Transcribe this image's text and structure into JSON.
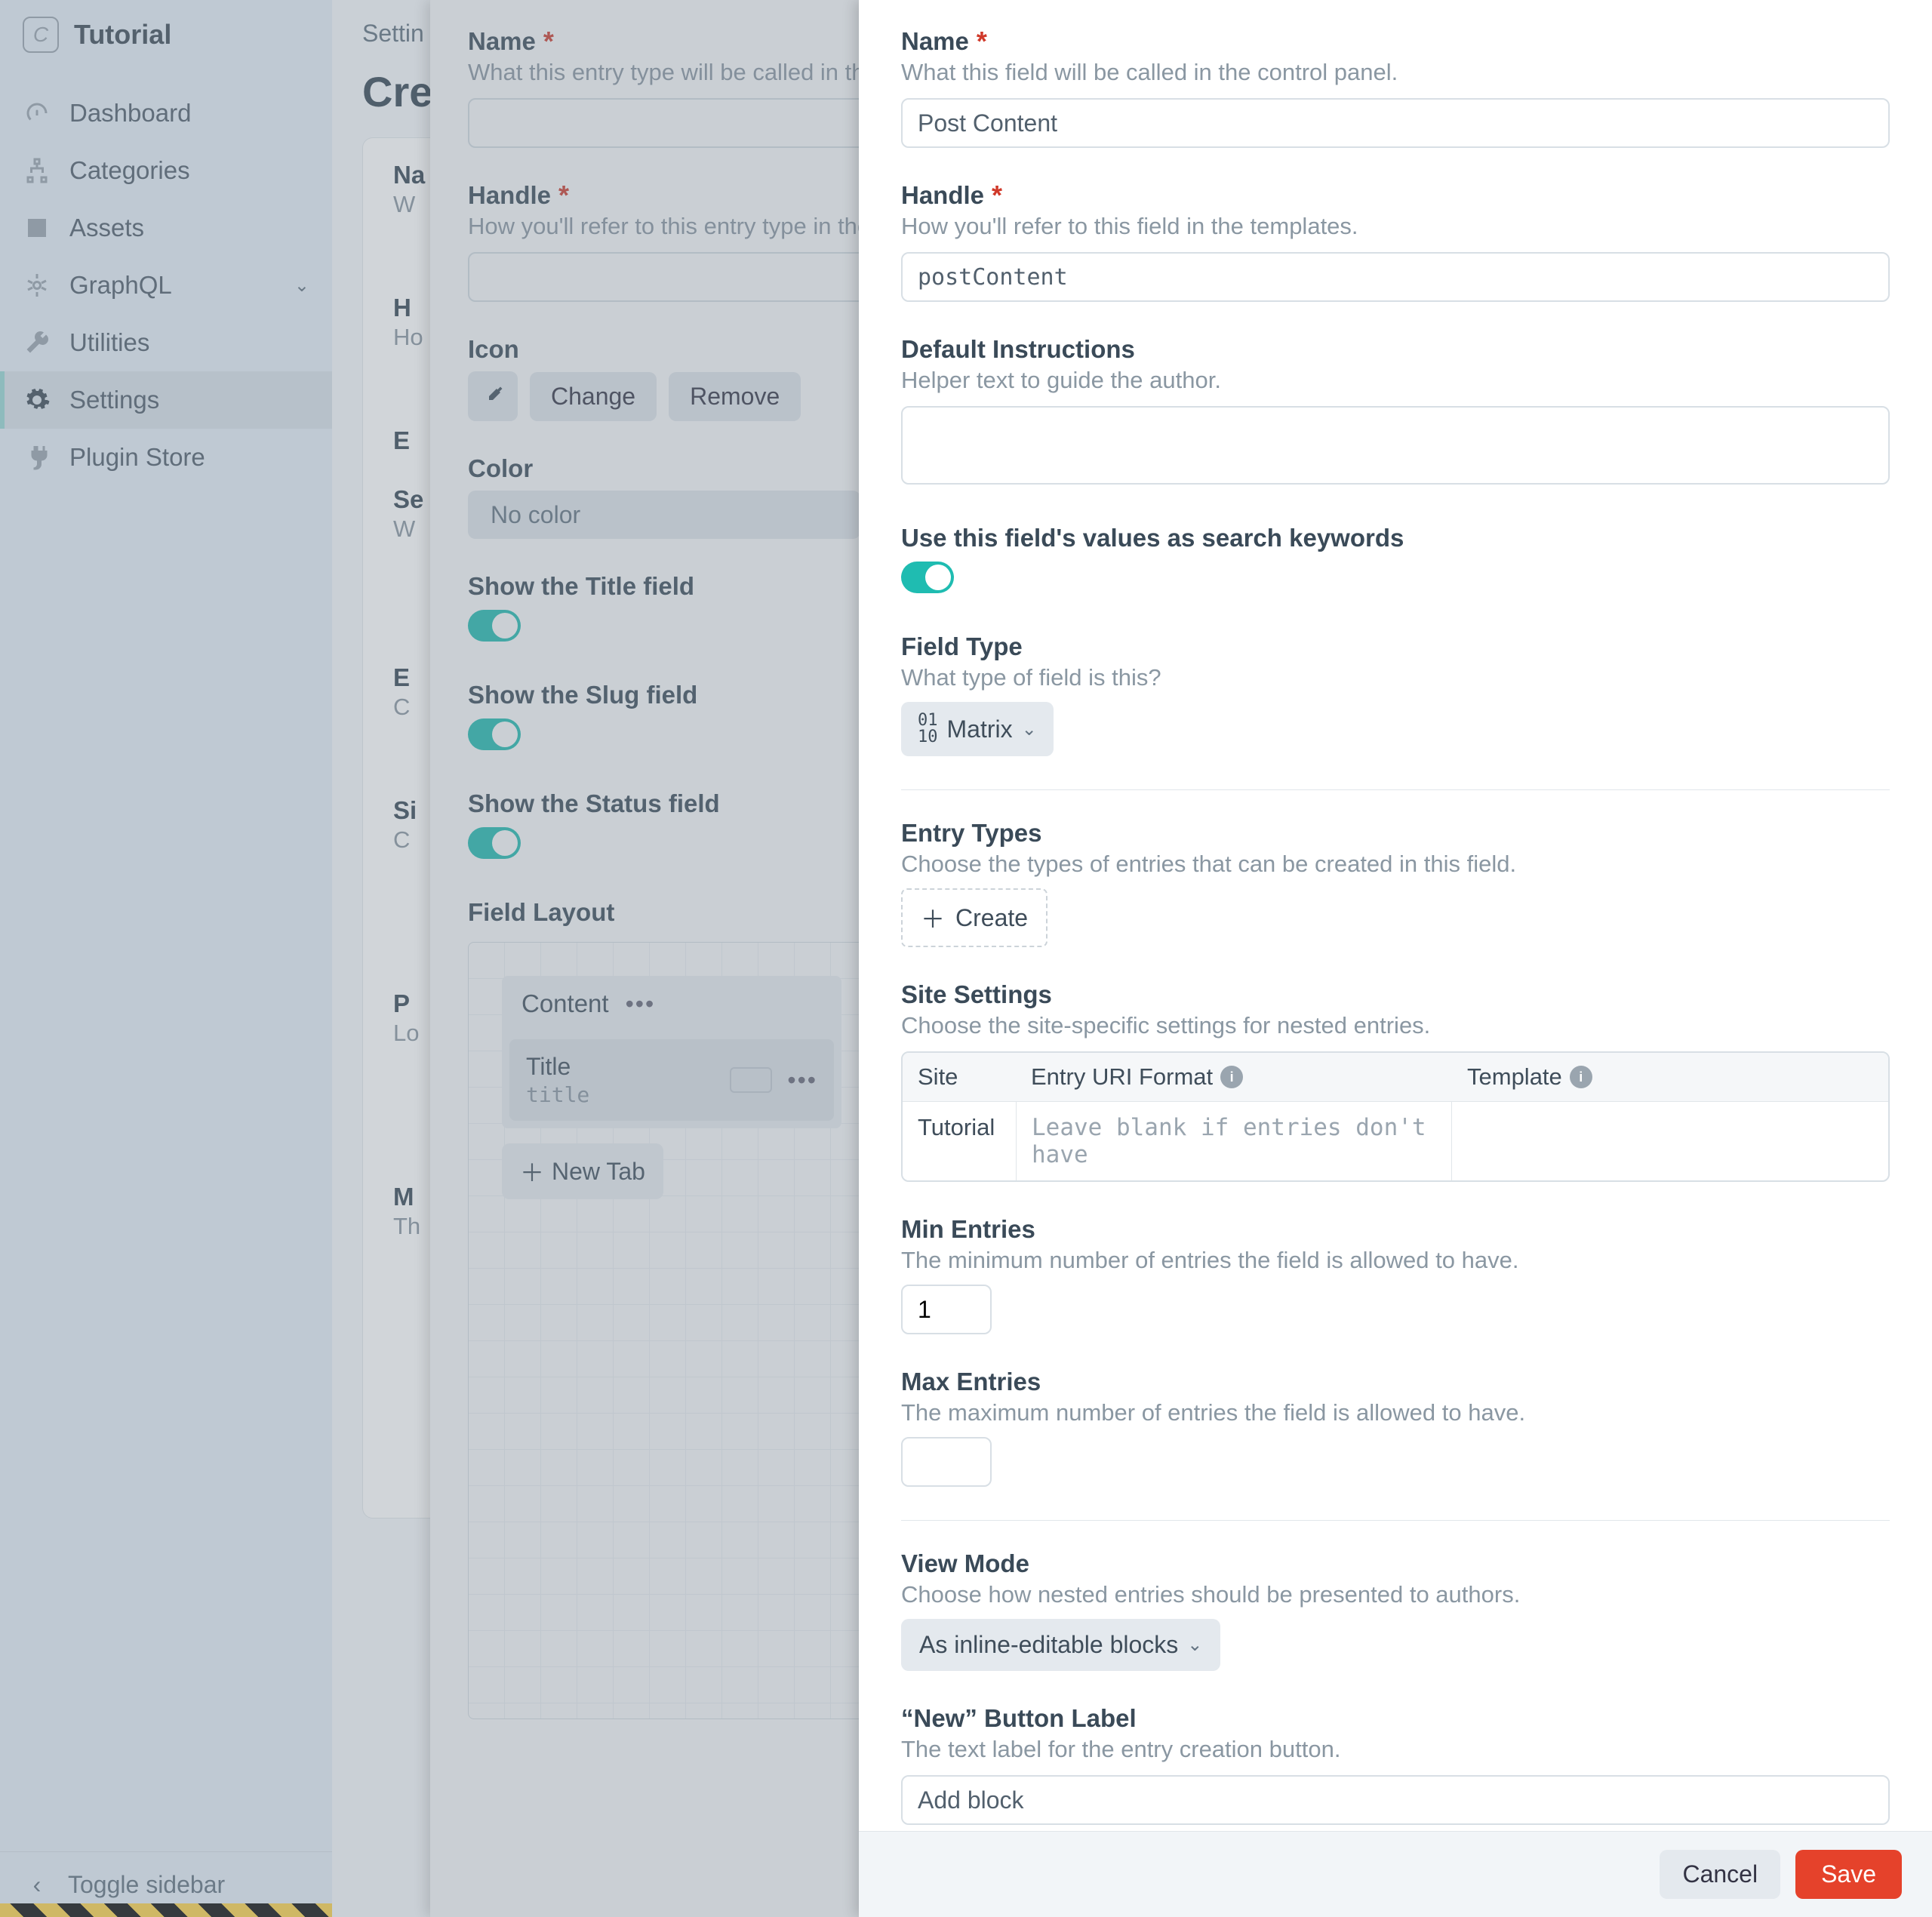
{
  "brand": "Tutorial",
  "sidebar": {
    "items": [
      {
        "label": "Dashboard"
      },
      {
        "label": "Categories"
      },
      {
        "label": "Assets"
      },
      {
        "label": "GraphQL"
      },
      {
        "label": "Utilities"
      },
      {
        "label": "Settings"
      },
      {
        "label": "Plugin Store"
      }
    ],
    "toggle": "Toggle sidebar"
  },
  "header": {
    "breadcrumb": "Settin",
    "page_title": "Crea"
  },
  "bg_card": {
    "na": "Na",
    "w1": "W",
    "h": "H",
    "ho": "Ho",
    "e": "E",
    "se": "Se",
    "w2": "W",
    "e2": "E",
    "c1": "C",
    "si": "Si",
    "c2": "C",
    "p": "P",
    "lo": "Lo",
    "m": "M",
    "th": "Th"
  },
  "entry_slide": {
    "name": {
      "label": "Name",
      "desc": "What this entry type will be called in the"
    },
    "handle": {
      "label": "Handle",
      "desc": "How you'll refer to this entry type in the t"
    },
    "icon": {
      "label": "Icon",
      "change": "Change",
      "remove": "Remove"
    },
    "color": {
      "label": "Color",
      "value": "No color"
    },
    "show_title": "Show the Title field",
    "show_slug": "Show the Slug field",
    "show_status": "Show the Status field",
    "layout": {
      "label": "Field Layout",
      "tab": "Content",
      "title": "Title",
      "handle": "title",
      "new_tab": "New Tab"
    }
  },
  "field": {
    "name": {
      "label": "Name",
      "desc": "What this field will be called in the control panel.",
      "value": "Post Content"
    },
    "handle": {
      "label": "Handle",
      "desc": "How you'll refer to this field in the templates.",
      "value": "postContent"
    },
    "instructions": {
      "label": "Default Instructions",
      "desc": "Helper text to guide the author."
    },
    "search": {
      "label": "Use this field's values as search keywords"
    },
    "type": {
      "label": "Field Type",
      "desc": "What type of field is this?",
      "value": "Matrix"
    },
    "entry_types": {
      "label": "Entry Types",
      "desc": "Choose the types of entries that can be created in this field.",
      "create": "Create"
    },
    "site_settings": {
      "label": "Site Settings",
      "desc": "Choose the site-specific settings for nested entries.",
      "col_site": "Site",
      "col_uri": "Entry URI Format",
      "col_tpl": "Template",
      "row_site": "Tutorial",
      "row_ph": "Leave blank if entries don't have"
    },
    "min": {
      "label": "Min Entries",
      "desc": "The minimum number of entries the field is allowed to have.",
      "value": "1"
    },
    "max": {
      "label": "Max Entries",
      "desc": "The maximum number of entries the field is allowed to have."
    },
    "view": {
      "label": "View Mode",
      "desc": "Choose how nested entries should be presented to authors.",
      "value": "As inline-editable blocks"
    },
    "new_label": {
      "label": "“New” Button Label",
      "desc": "The text label for the entry creation button.",
      "value": "Add block"
    },
    "cancel": "Cancel",
    "save": "Save"
  }
}
